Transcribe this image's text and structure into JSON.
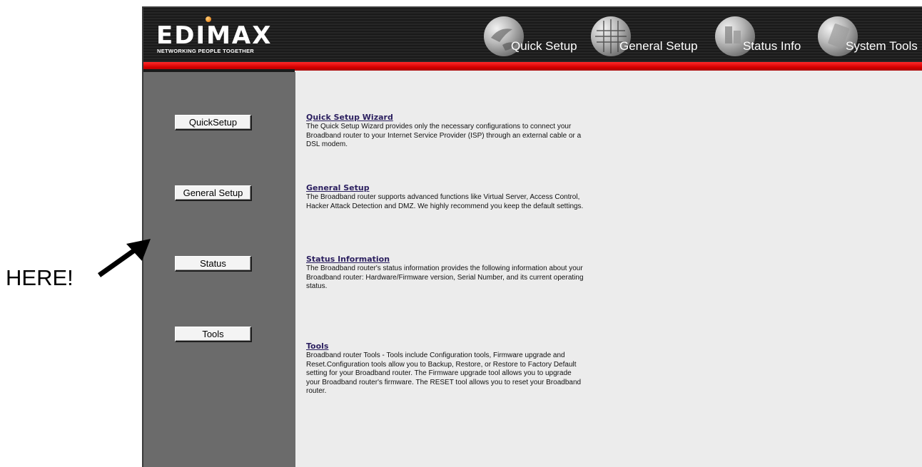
{
  "brand": {
    "name": "EDIMAX",
    "tagline": "NETWORKING PEOPLE TOGETHER"
  },
  "top_nav": [
    {
      "label": "Quick Setup",
      "icon": "globe-icon"
    },
    {
      "label": "General Setup",
      "icon": "globe-grid-icon"
    },
    {
      "label": "Status Info",
      "icon": "globe-status-icon"
    },
    {
      "label": "System Tools",
      "icon": "globe-tools-icon"
    }
  ],
  "sidebar": {
    "buttons": [
      {
        "label": "QuickSetup"
      },
      {
        "label": "General Setup"
      },
      {
        "label": "Status"
      },
      {
        "label": "Tools"
      }
    ]
  },
  "sections": [
    {
      "title": "Quick Setup Wizard",
      "lines": [
        "The Quick Setup Wizard provides only the necessary configurations to connect your",
        "Broadband router to your Internet Service Provider (ISP) through an external cable or a",
        "DSL modem."
      ]
    },
    {
      "title": "General Setup",
      "lines": [
        "The Broadband router supports advanced functions like Virtual Server, Access Control,",
        "Hacker Attack Detection and DMZ. We highly recommend you keep the default settings."
      ]
    },
    {
      "title": "Status Information",
      "lines": [
        "The Broadband router's status information provides the following information about your",
        "Broadband router: Hardware/Firmware version, Serial Number, and its current operating",
        "status."
      ]
    },
    {
      "title": "Tools",
      "lines": [
        "Broadband router Tools - Tools include Configuration tools, Firmware upgrade and",
        "Reset.Configuration tools allow you to Backup, Restore, or Restore to Factory Default",
        "setting for your Broadband router. The Firmware upgrade tool allows you to upgrade",
        "your Broadband router's firmware. The RESET tool allows you to reset your Broadband",
        "router."
      ]
    }
  ],
  "annotation": {
    "text": "HERE!"
  },
  "colors": {
    "header_bg": "#1f1f1f",
    "red_bar": "#e00000",
    "sidebar_bg": "#6b6b6b",
    "content_bg": "#ececec",
    "link": "#2b1f5f"
  }
}
